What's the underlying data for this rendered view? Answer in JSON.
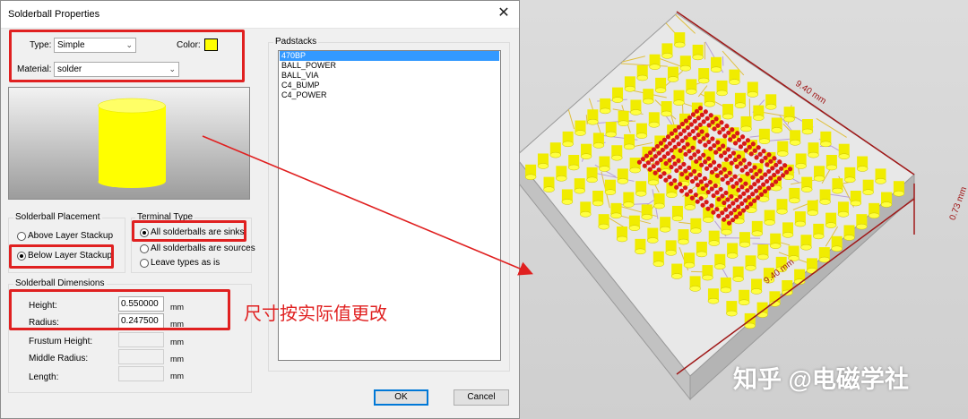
{
  "dialog": {
    "title": "Solderball Properties",
    "close_icon": "close-icon"
  },
  "props": {
    "type_label": "Type:",
    "type_value": "Simple",
    "color_label": "Color:",
    "color_value": "#ffff00",
    "material_label": "Material:",
    "material_value": "solder"
  },
  "placement": {
    "title": "Solderball Placement",
    "above": "Above Layer Stackup",
    "below": "Below Layer Stackup",
    "selected": "below"
  },
  "terminal": {
    "title": "Terminal Type",
    "sinks": "All solderballs are sinks",
    "sources": "All solderballs are sources",
    "leave": "Leave  types as is",
    "selected": "sinks"
  },
  "dimensions": {
    "title": "Solderball Dimensions",
    "height_label": "Height:",
    "height_value": "0.550000",
    "radius_label": "Radius:",
    "radius_value": "0.247500",
    "frustum_label": "Frustum Height:",
    "middle_label": "Middle Radius:",
    "length_label": "Length:",
    "unit": "mm"
  },
  "padstacks": {
    "title": "Padstacks",
    "items": [
      "470BP",
      "BALL_POWER",
      "BALL_VIA",
      "C4_BUMP",
      "C4_POWER"
    ],
    "selected_index": 0
  },
  "buttons": {
    "ok": "OK",
    "cancel": "Cancel"
  },
  "annotation": {
    "text": "尺寸按实际值更改"
  },
  "view": {
    "dim_top": "9.40 mm",
    "dim_bottom": "9.40 mm",
    "dim_side": "0.73 mm",
    "watermark": "知乎 @电磁学社"
  },
  "colors": {
    "highlight": "#e02020",
    "ball": "#ffff00",
    "bump": "#d81818"
  }
}
